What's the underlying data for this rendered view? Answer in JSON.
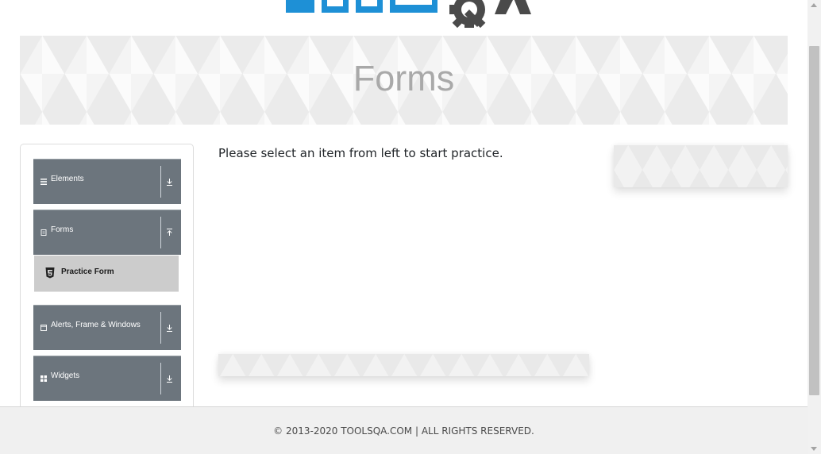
{
  "header": {
    "logo_name": "toolsqa-logo",
    "logo_color_primary": "#1e90d6",
    "logo_color_secondary": "#4a4a4a"
  },
  "banner": {
    "title": "Forms"
  },
  "sidebar": {
    "groups": [
      {
        "label": "Elements",
        "icon": "menu-icon",
        "expanded": false
      },
      {
        "label": "Forms",
        "icon": "document-icon",
        "expanded": true
      },
      {
        "label": "Alerts, Frame & Windows",
        "icon": "window-icon",
        "expanded": false
      },
      {
        "label": "Widgets",
        "icon": "grid-icon",
        "expanded": false
      }
    ],
    "forms_items": [
      {
        "label": "Practice Form",
        "icon": "html5-icon"
      }
    ],
    "group_color": "#6c757d",
    "active_item_color": "#cccccc"
  },
  "main": {
    "message": "Please select an item from left to start practice."
  },
  "footer": {
    "text": "© 2013-2020 TOOLSQA.COM | ALL RIGHTS RESERVED."
  }
}
